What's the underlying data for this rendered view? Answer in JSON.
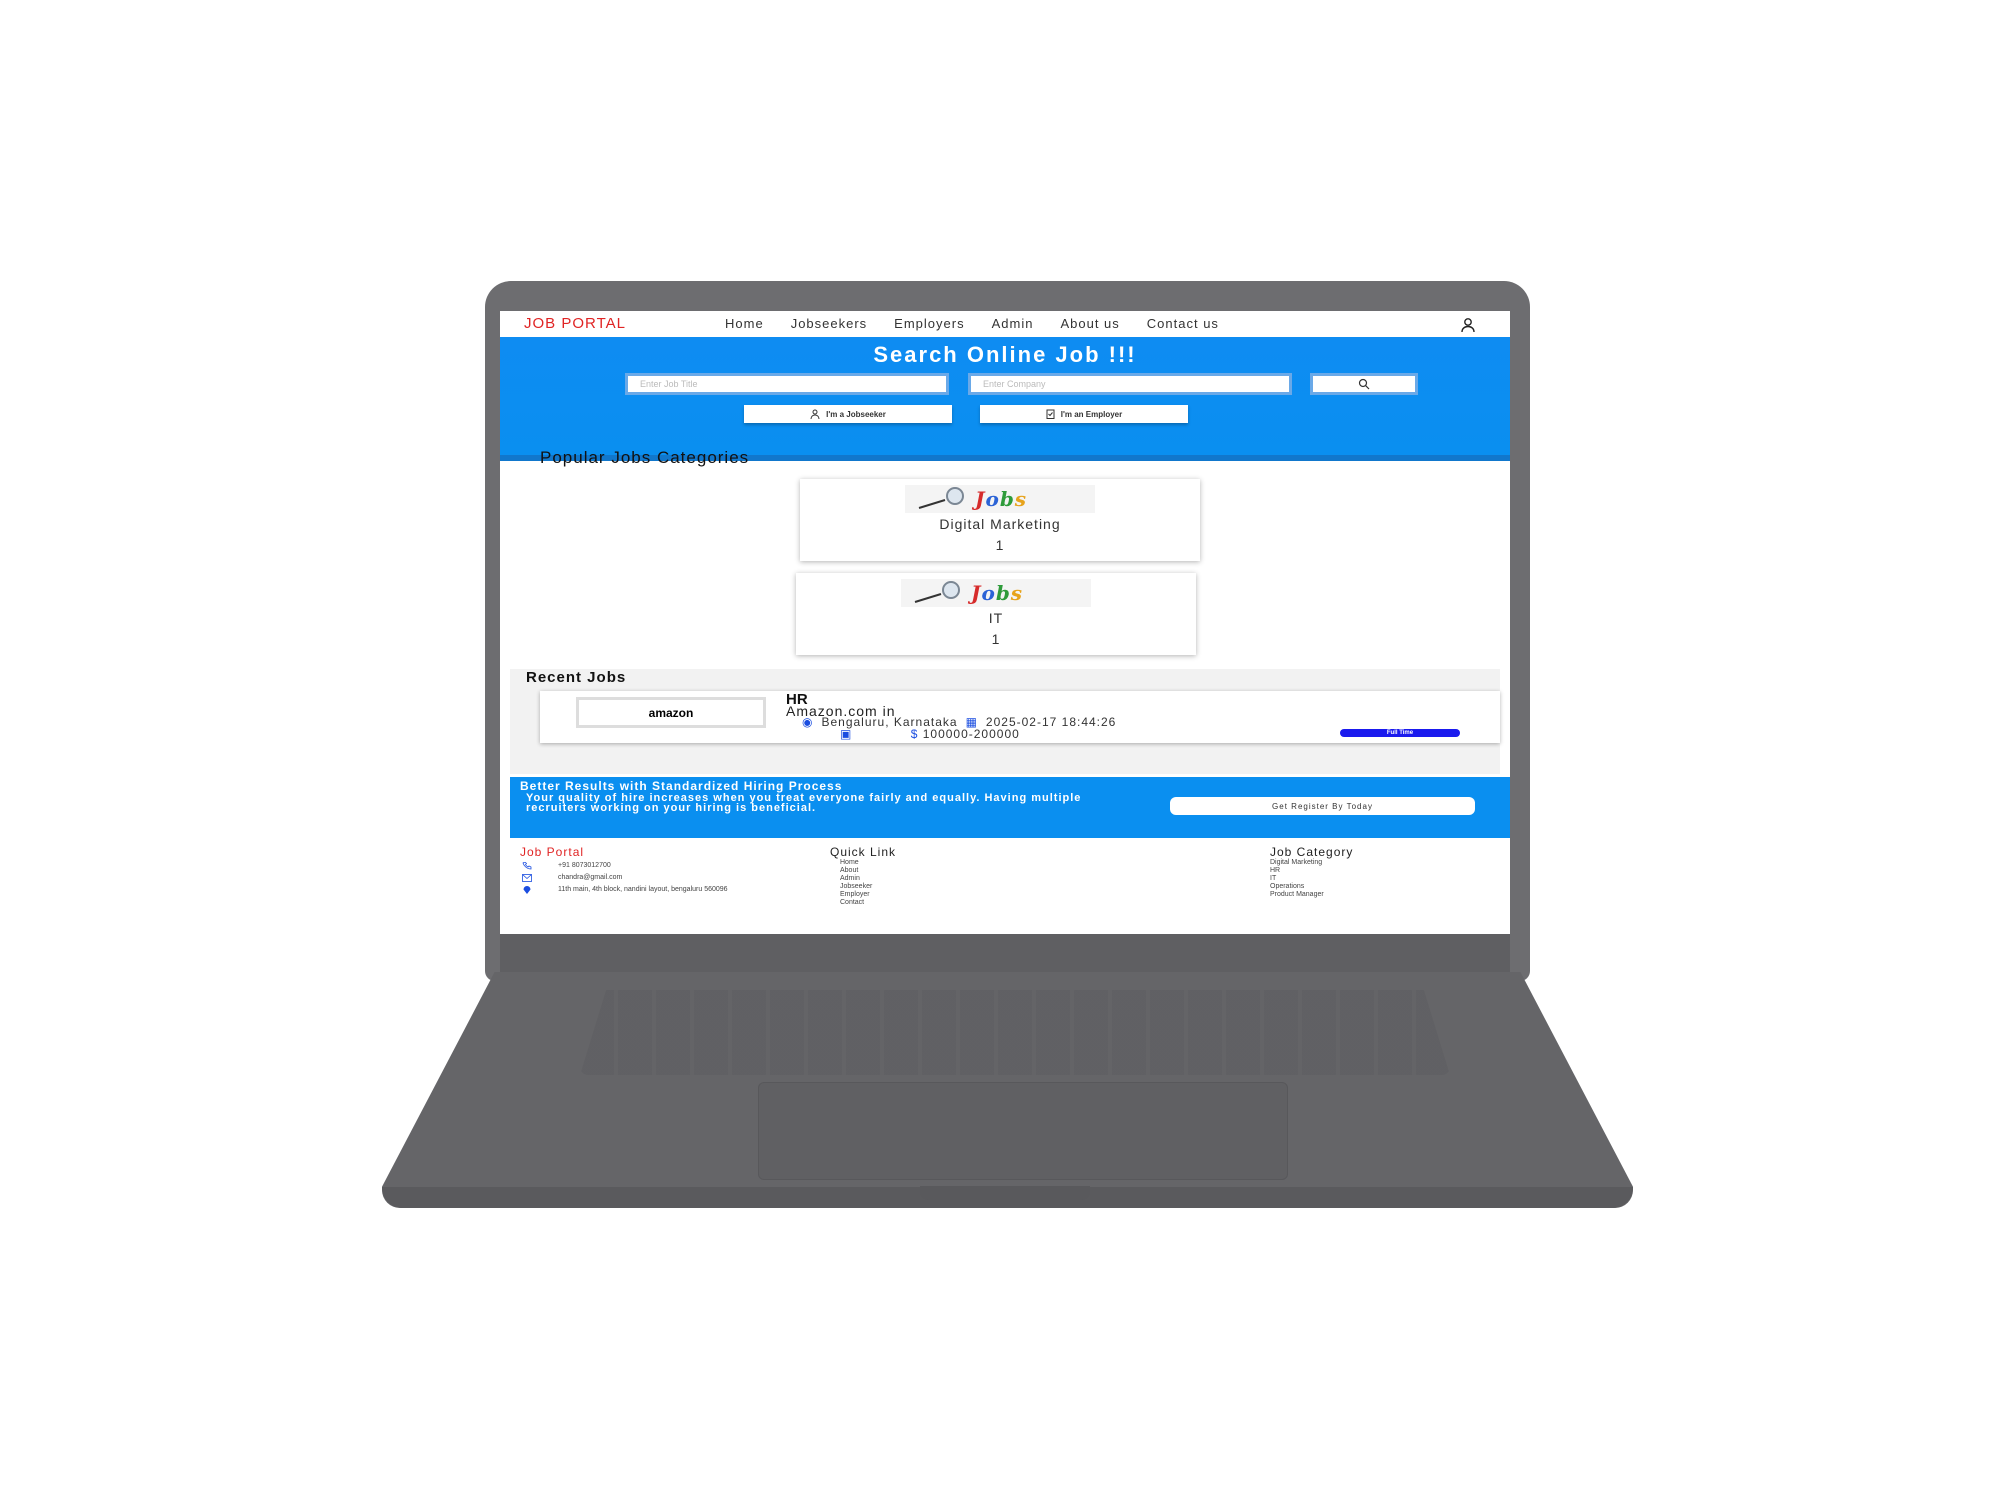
{
  "nav": {
    "brand": "JOB PORTAL",
    "links": [
      "Home",
      "Jobseekers",
      "Employers",
      "Admin",
      "About us",
      "Contact us"
    ]
  },
  "hero": {
    "title": "Search Online Job !!!",
    "job_title_placeholder": "Enter Job Title",
    "company_placeholder": "Enter Company",
    "jobseeker_button": "I'm a Jobseeker",
    "employer_button": "I'm an Employer"
  },
  "categories": {
    "title": "Popular Jobs Categories",
    "logo_text": "Jobs",
    "items": [
      {
        "name": "Digital Marketing",
        "count": "1"
      },
      {
        "name": "IT",
        "count": "1"
      }
    ]
  },
  "recent": {
    "title": "Recent Jobs",
    "jobs": [
      {
        "logo": "amazon",
        "title": "HR",
        "company": "Amazon.com in",
        "location": "Bengaluru, Karnataka",
        "posted": "2025-02-17  18:44:26",
        "salary": "100000-200000",
        "type": "Full Time"
      }
    ]
  },
  "cta": {
    "title": "Better Results with Standardized Hiring Process",
    "text": "Your quality of hire increases when you treat everyone fairly and equally. Having multiple recruiters working on your hiring is beneficial.",
    "button": "Get Register By Today"
  },
  "footer": {
    "brand": "Job Portal",
    "phone": "+91 8073012700",
    "email": "chandra@gmail.com",
    "address": "11th main, 4th block, nandini layout, bengaluru 560096",
    "quick_link_title": "Quick Link",
    "quick_links": [
      "Home",
      "About",
      "Admin",
      "Jobseeker",
      "Employer",
      "Contact"
    ],
    "category_title": "Job Category",
    "categories": [
      "Digital Marketing",
      "HR",
      "IT",
      "Operations",
      "Product Manager"
    ]
  },
  "colors": {
    "brand_red": "#e02424",
    "hero_blue": "#0a8ff0",
    "badge_blue": "#1a1aee",
    "laptop_gray": "#6d6d70"
  }
}
